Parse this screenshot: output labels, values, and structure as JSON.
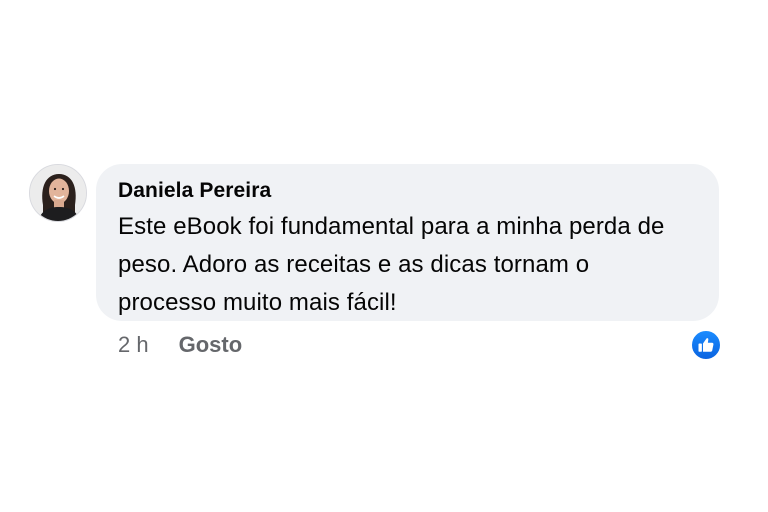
{
  "comment": {
    "author": "Daniela Pereira",
    "text": "Este eBook foi fundamental para a minha perda de peso. Adoro as receitas e as dicas tornam o processo muito mais fácil!",
    "time": "2 h",
    "like_label": "Gosto",
    "reaction_icon": "thumbs-up-icon",
    "reaction_color": "#1877f2",
    "bubble_color": "#f0f2f5",
    "meta_color": "#65676b"
  }
}
